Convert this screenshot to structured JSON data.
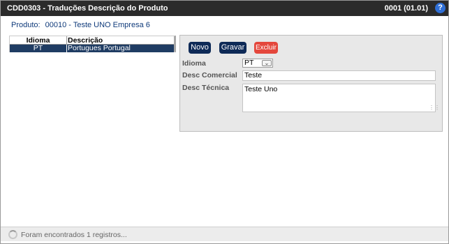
{
  "window": {
    "title": "CDD0303 - Traduções Descrição do Produto",
    "version": "0001 (01.01)",
    "help_label": "?"
  },
  "product": {
    "label": "Produto:",
    "value": "00010 - Teste UNO Empresa 6"
  },
  "grid": {
    "columns": [
      "Idioma",
      "Descrição"
    ],
    "rows": [
      {
        "idioma": "PT",
        "descricao": "Portugues Portugal"
      }
    ]
  },
  "toolbar": {
    "novo_label": "Novo",
    "gravar_label": "Gravar",
    "excluir_label": "Excluir"
  },
  "form": {
    "idioma_label": "Idioma",
    "idioma_value": "PT",
    "desc_comercial_label": "Desc Comercial",
    "desc_comercial_value": "Teste",
    "desc_tecnica_label": "Desc Técnica",
    "desc_tecnica_value": "Teste Uno"
  },
  "status": {
    "message": "Foram encontrados 1 registros..."
  },
  "icons": {
    "help": "help-icon",
    "dropdown": "chevron-down-icon",
    "resize": "resize-grip-icon",
    "loading": "spinner-icon"
  },
  "colors": {
    "titlebar_bg": "#2b2b2b",
    "primary_button": "#0e2a57",
    "danger_button": "#e4473c",
    "selected_row": "#1f3c63",
    "help_icon": "#2f6fd6"
  }
}
